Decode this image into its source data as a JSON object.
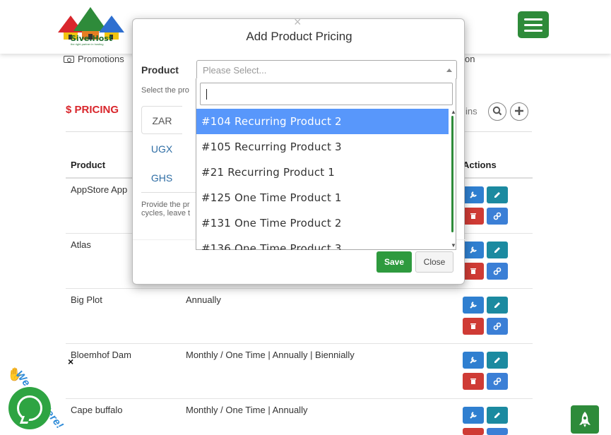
{
  "header": {
    "logo_text": "Sive.Host",
    "logo_tagline": "the right partner in hosting"
  },
  "nav": {
    "promotions": "Promotions",
    "right_fragment": "on"
  },
  "pricing": {
    "title": "$ PRICING",
    "ins_text": "ins"
  },
  "table": {
    "headers": [
      "Product",
      "Actions"
    ],
    "rows": [
      {
        "name": "AppStore App",
        "cycles": ""
      },
      {
        "name": "Atlas",
        "cycles": ""
      },
      {
        "name": "Big Plot",
        "cycles": "Annually"
      },
      {
        "name": "Bloemhof Dam",
        "cycles": "Monthly / One Time | Annually | Biennially"
      },
      {
        "name": "Cape buffalo",
        "cycles": "Monthly / One Time | Annually"
      }
    ]
  },
  "chat": {
    "badge": "We Are Here!",
    "close": "×"
  },
  "modal": {
    "close": "×",
    "title": "Add Product Pricing",
    "product_label": "Product",
    "select_placeholder": "Please Select...",
    "help_text": "Select the pro",
    "tabs": [
      "ZAR",
      "UGX",
      "GHS"
    ],
    "help_text2_line1": "Provide the pr",
    "help_text2_line2": "cycles, leave t",
    "save": "Save",
    "close_button": "Close"
  },
  "dropdown": {
    "search_value": "",
    "items": [
      "#104 Recurring Product 2",
      "#105 Recurring Product 3",
      "#21 Recurring Product 1",
      "#125 One Time Product 1",
      "#131 One Time Product 2",
      "#136 One Time Product 3"
    ],
    "highlighted_index": 0
  },
  "colors": {
    "brand_green": "#2e8b3a",
    "highlight_blue": "#5897fb",
    "pricing_red": "#d9262c"
  }
}
